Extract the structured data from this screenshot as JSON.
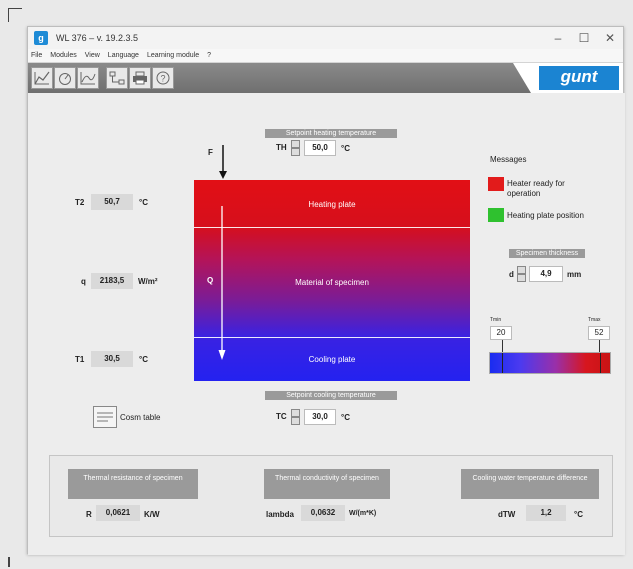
{
  "window": {
    "title": "WL 376 – v. 19.2.3.5",
    "icon_letter": "g",
    "controls": [
      "–",
      "☐",
      "✕"
    ]
  },
  "menu": [
    "File",
    "Modules",
    "View",
    "Language",
    "Learning module",
    "?"
  ],
  "toolbar": {
    "icons": [
      "chart-icon",
      "gauge-icon",
      "graph-icon",
      "network-icon",
      "printer-icon",
      "help-icon"
    ],
    "logo": "gunt"
  },
  "setpoint_heating": {
    "label": "Setpoint heating temperature",
    "var": "TH",
    "value": "50,0",
    "unit": "°C"
  },
  "setpoint_cooling": {
    "label": "Setpoint cooling temperature",
    "var": "TC",
    "value": "30,0",
    "unit": "°C"
  },
  "left_readings": {
    "t2": {
      "var": "T2",
      "value": "50,7",
      "unit": "°C"
    },
    "q": {
      "var": "q",
      "value": "2183,5",
      "unit": "W/m²"
    },
    "t1": {
      "var": "T1",
      "value": "30,5",
      "unit": "°C"
    }
  },
  "specimen": {
    "force_label": "F",
    "flow_label": "Q",
    "heating": "Heating plate",
    "material": "Material of specimen",
    "cooling": "Cooling plate"
  },
  "messages": {
    "title": "Messages",
    "items": [
      {
        "text": "Heater ready for operation",
        "color": "#e21b1b"
      },
      {
        "text": "Heating plate position",
        "color": "#2fc12f"
      }
    ]
  },
  "thickness": {
    "label": "Specimen thickness",
    "var": "d",
    "value": "4,9",
    "unit": "mm"
  },
  "scale": {
    "min_label": "Tmin",
    "max_label": "Tmax",
    "min_value": "20",
    "max_value": "52"
  },
  "cosm_table": {
    "label": "Cosm table"
  },
  "results": {
    "resistance": {
      "label": "Thermal resistance of specimen",
      "var": "R",
      "value": "0,0621",
      "unit": "K/W"
    },
    "conductivity": {
      "label": "Thermal conductivity of specimen",
      "var": "lambda",
      "value": "0,0632",
      "unit": "W/(m*K)"
    },
    "cooling_water": {
      "label": "Cooling water temperature difference",
      "var": "dTW",
      "value": "1,2",
      "unit": "°C"
    }
  }
}
